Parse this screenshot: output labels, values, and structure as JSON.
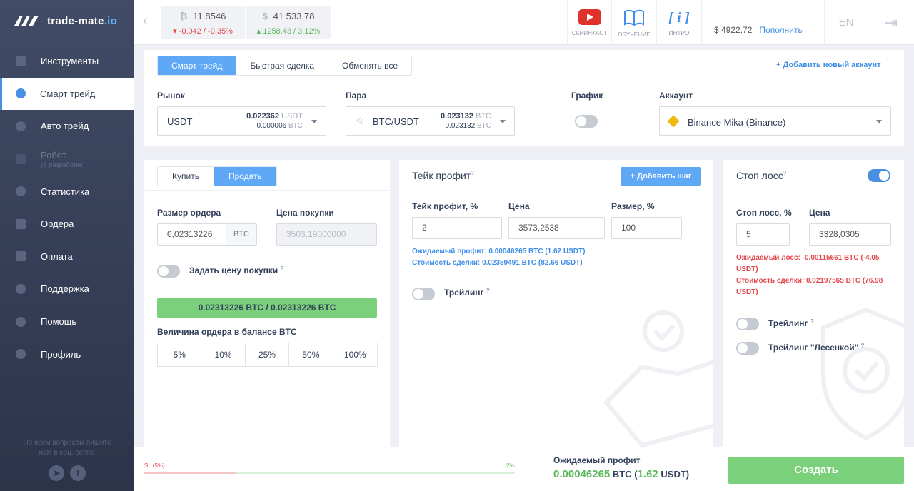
{
  "brand": {
    "name": "trade-mate",
    "tld": ".io"
  },
  "sidebar": {
    "items": [
      {
        "label": "Инструменты"
      },
      {
        "label": "Смарт трейд"
      },
      {
        "label": "Авто трейд"
      },
      {
        "label": "Робот",
        "sub": "(В разработке)"
      },
      {
        "label": "Статистика"
      },
      {
        "label": "Ордера"
      },
      {
        "label": "Оплата"
      },
      {
        "label": "Поддержка"
      },
      {
        "label": "Помощь"
      },
      {
        "label": "Профиль"
      }
    ],
    "footer_line1": "По всем вопросам пишите",
    "footer_line2": "нам в соц. сетях:"
  },
  "header": {
    "tickers": [
      {
        "symbol": "₿",
        "value": "11.8546",
        "change": "-0.042 / -0.35%",
        "direction": "down"
      },
      {
        "symbol": "$",
        "value": "41 533.78",
        "change": "1258.43 / 3.12%",
        "direction": "up"
      }
    ],
    "screencast": "СКРИНКАСТ",
    "learning": "ОБУЧЕНИЕ",
    "intro": "ИНТРО",
    "balance": "$ 4922.72",
    "topup": "Пополнить",
    "lang": "EN"
  },
  "trade": {
    "tabs": [
      "Смарт трейд",
      "Быстрая сделка",
      "Обменять все"
    ],
    "add_account": "+ Добавить новый аккаунт",
    "market_label": "Рынок",
    "market": {
      "name": "USDT",
      "p1": "0.022362",
      "c1": "USDT",
      "p2": "0.000006",
      "c2": "BTC"
    },
    "pair_label": "Пара",
    "pair": {
      "name": "BTC/USDT",
      "p1": "0.023132",
      "c1": "BTC",
      "p2": "0.023132",
      "c2": "BTC"
    },
    "chart_label": "График",
    "account_label": "Аккаунт",
    "account": "Binance Mika (Binance)"
  },
  "order": {
    "tabs": [
      "Купить",
      "Продать"
    ],
    "size_label": "Размер ордера",
    "size_value": "0,02313226",
    "size_unit": "BTC",
    "buy_price_label": "Цена покупки",
    "buy_price_placeholder": "3503,19000000",
    "set_price_label": "Задать цену покупки",
    "summary": "0.02313226 BTC / 0.02313226 BTC",
    "balance_label": "Величина ордера в балансе BTC",
    "percents": [
      "5%",
      "10%",
      "25%",
      "50%",
      "100%"
    ]
  },
  "take_profit": {
    "title": "Тейк профит",
    "add_step": "Добавить шаг",
    "tp_label": "Тейк профит, %",
    "tp_value": "2",
    "price_label": "Цена",
    "price_value": "3573,2538",
    "size_label": "Размер, %",
    "size_value": "100",
    "expected": "Ожидаемый профит: 0.00046265 BTC (1.62 USDT)",
    "cost": "Стоимость сделки: 0.02359491 BTC (82.66 USDT)",
    "trailing": "Трейлинг"
  },
  "stop_loss": {
    "title": "Стоп лосс",
    "sl_label": "Стоп лосс, %",
    "sl_value": "5",
    "price_label": "Цена",
    "price_value": "3328,0305",
    "expected_1": "Ожидаемый лосс: -0.00115661 BTC (-4.05",
    "expected_2": "USDT)",
    "cost_1": "Стоимость сделки: 0.02197565 BTC (76.98",
    "cost_2": "USDT)",
    "trailing": "Трейлинг",
    "trailing_ladder": "Трейлинг \"Лесенкой\""
  },
  "footer": {
    "sl_marker": "SL (5%)",
    "tp_marker": "2%",
    "expected_label": "Ожидаемый профит",
    "expected_btc": "0.00046265",
    "btc": "BTC",
    "open": "(",
    "expected_usdt": "1.62",
    "usdt": "USDT)",
    "create": "Создать"
  },
  "colors": {
    "accent": "#5fa8f5",
    "green": "#7bd07b",
    "red": "#e2474b",
    "sidebar": "#3a4360"
  }
}
